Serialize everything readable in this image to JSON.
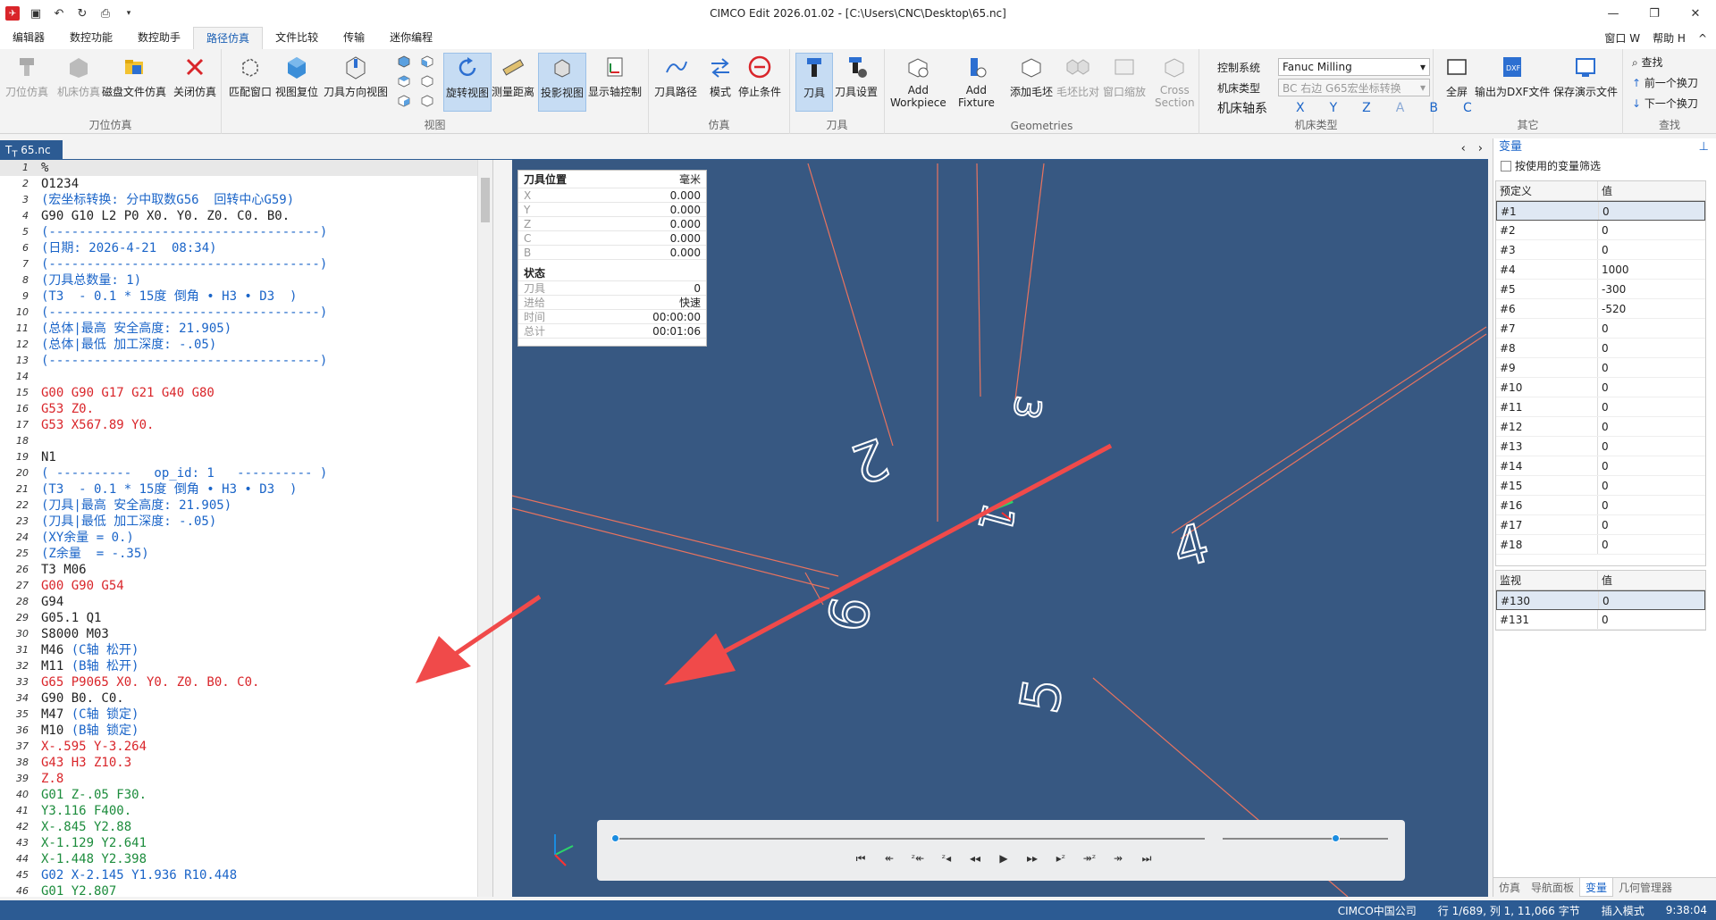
{
  "window": {
    "title": "CIMCO Edit 2026.01.02 - [C:\\Users\\CNC\\Desktop\\65.nc]"
  },
  "ribbon_tabs": [
    "编辑器",
    "数控功能",
    "数控助手",
    "路径仿真",
    "文件比较",
    "传输",
    "迷你编程"
  ],
  "ribbon_right": {
    "window": "窗口 W",
    "help": "帮助 H"
  },
  "groups": {
    "tool_sim": {
      "label": "刀位仿真",
      "buttons": [
        "刀位仿真",
        "机床仿真",
        "磁盘文件仿真",
        "关闭仿真"
      ]
    },
    "view": {
      "label": "视图",
      "buttons": [
        "匹配窗口",
        "视图复位",
        "刀具方向视图",
        "旋转视图",
        "测量距离",
        "投影视图",
        "显示轴控制"
      ]
    },
    "sim": {
      "label": "仿真",
      "buttons": [
        "刀具路径",
        "模式",
        "停止条件"
      ]
    },
    "tool": {
      "label": "刀具",
      "buttons": [
        "刀具",
        "刀具设置"
      ]
    },
    "geometries": {
      "label": "Geometries",
      "buttons": [
        "Add\nWorkpiece",
        "Add\nFixture",
        "添加毛坯",
        "毛坯比对",
        "窗口缩放",
        "Cross\nSection"
      ]
    },
    "machine_type": {
      "label": "机床类型",
      "control_label": "控制系统",
      "control_value": "Fanuc Milling",
      "type_label": "机床类型",
      "type_value": "BC 右边 G65宏坐标转换",
      "axes_label": "机床轴系",
      "axes": [
        "X",
        "Y",
        "Z",
        "A",
        "B",
        "C"
      ]
    },
    "other": {
      "label": "其它",
      "buttons": [
        "全屏",
        "输出为DXF文件",
        "保存演示文件"
      ]
    },
    "find": {
      "label": "查找",
      "items": [
        "查找",
        "前一个换刀",
        "下一个换刀"
      ]
    }
  },
  "doc_tab": "65.nc",
  "code_lines": [
    {
      "n": "1",
      "t": "%",
      "c": "b"
    },
    {
      "n": "2",
      "t": "O1234",
      "c": "b"
    },
    {
      "n": "3",
      "t": "(宏坐标转换: 分中取数G56  回转中心G59)",
      "c": "u"
    },
    {
      "n": "4",
      "t": "G90 G10 L2 P0 X0. Y0. Z0. C0. B0.",
      "c": "b"
    },
    {
      "n": "5",
      "t": "(------------------------------------)",
      "c": "u"
    },
    {
      "n": "6",
      "t": "(日期: 2026-4-21  08:34)",
      "c": "u"
    },
    {
      "n": "7",
      "t": "(------------------------------------)",
      "c": "u"
    },
    {
      "n": "8",
      "t": "(刀具总数量: 1)",
      "c": "u"
    },
    {
      "n": "9",
      "t": "(T3  - 0.1 * 15度 倒角 • H3 • D3  )",
      "c": "u"
    },
    {
      "n": "10",
      "t": "(------------------------------------)",
      "c": "u"
    },
    {
      "n": "11",
      "t": "(总体|最高 安全高度: 21.905)",
      "c": "u"
    },
    {
      "n": "12",
      "t": "(总体|最低 加工深度: -.05)",
      "c": "u"
    },
    {
      "n": "13",
      "t": "(------------------------------------)",
      "c": "u"
    },
    {
      "n": "14",
      "t": "",
      "c": "b"
    },
    {
      "n": "15",
      "t": "G00 G90 G17 G21 G40 G80",
      "c": "r"
    },
    {
      "n": "16",
      "t": "G53 Z0.",
      "c": "r"
    },
    {
      "n": "17",
      "t": "G53 X567.89 Y0.",
      "c": "r"
    },
    {
      "n": "18",
      "t": "",
      "c": "b"
    },
    {
      "n": "19",
      "t": "N1",
      "c": "b"
    },
    {
      "n": "20",
      "t": "( ----------   op_id: 1   ---------- )",
      "c": "u"
    },
    {
      "n": "21",
      "t": "(T3  - 0.1 * 15度 倒角 • H3 • D3  )",
      "c": "u"
    },
    {
      "n": "22",
      "t": "(刀具|最高 安全高度: 21.905)",
      "c": "u"
    },
    {
      "n": "23",
      "t": "(刀具|最低 加工深度: -.05)",
      "c": "u"
    },
    {
      "n": "24",
      "t": "(XY余量 = 0.)",
      "c": "u"
    },
    {
      "n": "25",
      "t": "(Z余量  = -.35)",
      "c": "u"
    },
    {
      "n": "26",
      "t": "T3 M06",
      "c": "b"
    },
    {
      "n": "27",
      "t": "G00 G90 G54",
      "c": "r"
    },
    {
      "n": "28",
      "t": "G94",
      "c": "b"
    },
    {
      "n": "29",
      "t": "G05.1 Q1",
      "c": "b"
    },
    {
      "n": "30",
      "t": "S8000 M03",
      "c": "b"
    },
    {
      "n": "31",
      "t": "M46 (C轴 松开)",
      "c": "mix1"
    },
    {
      "n": "32",
      "t": "M11 (B轴 松开)",
      "c": "mix2"
    },
    {
      "n": "33",
      "t": "G65 P9065 X0. Y0. Z0. B0. C0.",
      "c": "r"
    },
    {
      "n": "34",
      "t": "G90 B0. C0.",
      "c": "b"
    },
    {
      "n": "35",
      "t": "M47 (C轴 锁定)",
      "c": "mix3"
    },
    {
      "n": "36",
      "t": "M10 (B轴 锁定)",
      "c": "mix4"
    },
    {
      "n": "37",
      "t": "X-.595 Y-3.264",
      "c": "r"
    },
    {
      "n": "38",
      "t": "G43 H3 Z10.3",
      "c": "r"
    },
    {
      "n": "39",
      "t": "Z.8",
      "c": "r"
    },
    {
      "n": "40",
      "t": "G01 Z-.05 F30.",
      "c": "g"
    },
    {
      "n": "41",
      "t": "Y3.116 F400.",
      "c": "g"
    },
    {
      "n": "42",
      "t": "X-.845 Y2.88",
      "c": "g"
    },
    {
      "n": "43",
      "t": "X-1.129 Y2.641",
      "c": "g"
    },
    {
      "n": "44",
      "t": "X-1.448 Y2.398",
      "c": "g"
    },
    {
      "n": "45",
      "t": "G02 X-2.145 Y1.936 R10.448",
      "c": "u"
    },
    {
      "n": "46",
      "t": "G01 Y2.807",
      "c": "g"
    }
  ],
  "code_mix": {
    "mix1": [
      "M46 ",
      "(C轴 松开)"
    ],
    "mix2": [
      "M11 ",
      "(B轴 松开)"
    ],
    "mix3": [
      "M47 ",
      "(C轴 锁定)"
    ],
    "mix4": [
      "M10 ",
      "(B轴 锁定)"
    ]
  },
  "tool_position": {
    "header": "刀具位置",
    "unit": "毫米",
    "rows": [
      [
        "X",
        "0.000"
      ],
      [
        "Y",
        "0.000"
      ],
      [
        "Z",
        "0.000"
      ],
      [
        "C",
        "0.000"
      ],
      [
        "B",
        "0.000"
      ]
    ],
    "status_header": "状态",
    "status_rows": [
      [
        "刀具",
        "0"
      ],
      [
        "进给",
        "快速"
      ],
      [
        "时间",
        "00:00:00"
      ],
      [
        "总计",
        "00:01:06"
      ]
    ]
  },
  "viewport_labels": [
    "1",
    "2",
    "3",
    "4",
    "5",
    "6"
  ],
  "playback": {
    "progress": 0.0,
    "speed": 0.68
  },
  "variables": {
    "title": "变量",
    "filter_label": "按使用的变量筛选",
    "table1_headers": [
      "预定义",
      "值"
    ],
    "table1_rows": [
      [
        "#1",
        "0"
      ],
      [
        "#2",
        "0"
      ],
      [
        "#3",
        "0"
      ],
      [
        "#4",
        "1000"
      ],
      [
        "#5",
        "-300"
      ],
      [
        "#6",
        "-520"
      ],
      [
        "#7",
        "0"
      ],
      [
        "#8",
        "0"
      ],
      [
        "#9",
        "0"
      ],
      [
        "#10",
        "0"
      ],
      [
        "#11",
        "0"
      ],
      [
        "#12",
        "0"
      ],
      [
        "#13",
        "0"
      ],
      [
        "#14",
        "0"
      ],
      [
        "#15",
        "0"
      ],
      [
        "#16",
        "0"
      ],
      [
        "#17",
        "0"
      ],
      [
        "#18",
        "0"
      ]
    ],
    "table2_headers": [
      "监视",
      "值"
    ],
    "table2_rows": [
      [
        "#130",
        "0"
      ],
      [
        "#131",
        "0"
      ]
    ],
    "bottom_tabs": [
      "仿真",
      "导航面板",
      "变量",
      "几何管理器"
    ]
  },
  "status": {
    "company": "CIMCO中国公司",
    "position": "行 1/689, 列 1, 11,066 字节",
    "mode": "插入模式",
    "time": "9:38:04"
  },
  "colors": {
    "accent": "#2c5b93",
    "viewport_bg": "#375882",
    "path_red": "#e8735f",
    "arrow_red": "#f04a4a"
  }
}
